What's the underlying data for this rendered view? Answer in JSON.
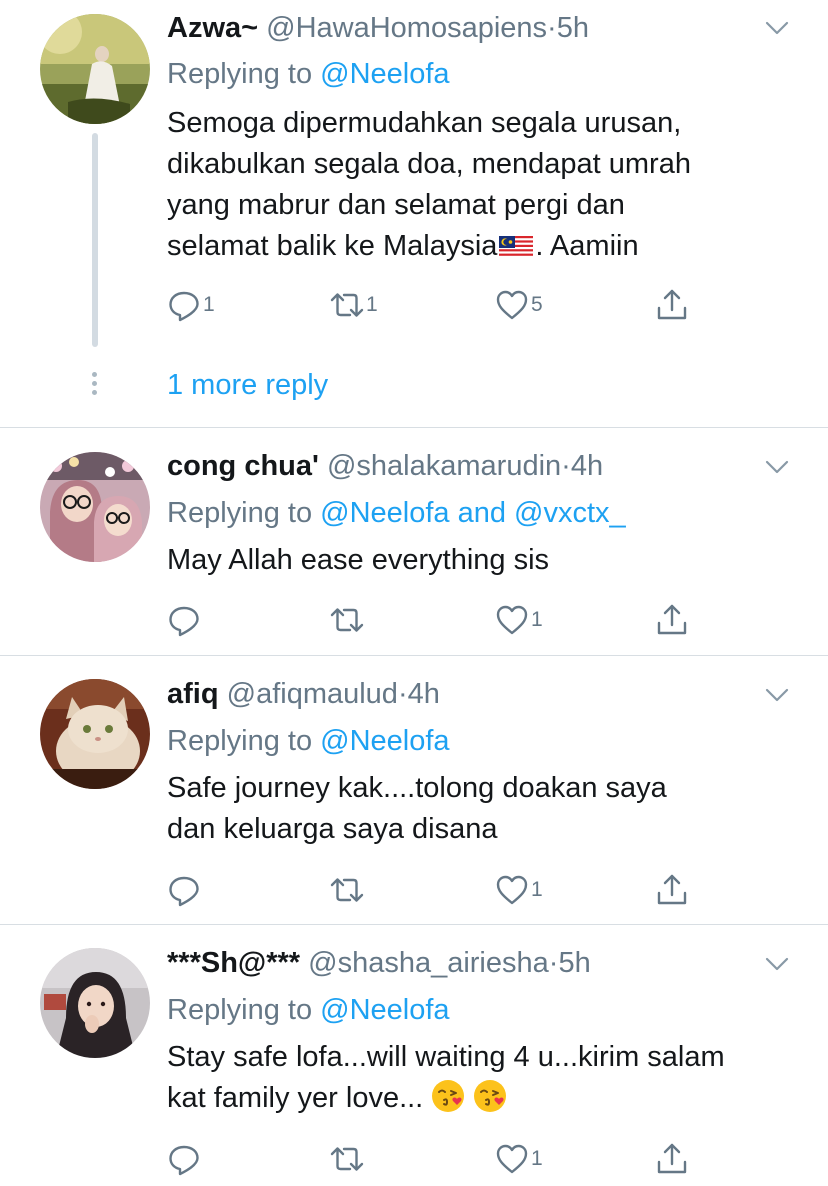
{
  "tweets": [
    {
      "name": "Azwa~",
      "handle": "@HawaHomosapiens",
      "time": "5h",
      "replying_prefix": "Replying to",
      "mentions": "@Neelofa",
      "text_lines": [
        "Semoga dipermudahkan segala urusan,",
        "dikabulkan segala doa, mendapat umrah",
        "yang mabrur dan selamat pergi dan",
        "selamat balik ke Malaysia",
        ". Aamiin"
      ],
      "reply_count": "1",
      "retweet_count": "1",
      "like_count": "5"
    },
    {
      "name": "cong chua'",
      "handle": "@shalakamarudin",
      "time": "4h",
      "replying_prefix": "Replying to",
      "mentions": "@Neelofa and @vxctx_",
      "text_lines": [
        "May Allah ease everything sis"
      ],
      "reply_count": "",
      "retweet_count": "",
      "like_count": "1"
    },
    {
      "name": "afiq",
      "handle": "@afiqmaulud",
      "time": "4h",
      "replying_prefix": "Replying to",
      "mentions": "@Neelofa",
      "text_lines": [
        "Safe journey kak....tolong doakan saya",
        "dan keluarga saya disana"
      ],
      "reply_count": "",
      "retweet_count": "",
      "like_count": "1"
    },
    {
      "name": "***Sh@***",
      "handle": "@shasha_airiesha",
      "time": "5h",
      "replying_prefix": "Replying to",
      "mentions": "@Neelofa",
      "text_lines": [
        "Stay safe lofa...will waiting 4 u...kirim salam",
        "kat family yer love..."
      ],
      "reply_count": "",
      "retweet_count": "",
      "like_count": "1"
    }
  ],
  "thread": {
    "more_reply_label": "1 more reply"
  },
  "icons": {
    "reply": "reply-icon",
    "retweet": "retweet-icon",
    "like": "heart-icon",
    "share": "share-icon",
    "menu": "chevron-down-icon",
    "flag": "malaysia-flag-emoji",
    "emoji": "face-blowing-kiss-emoji"
  },
  "colors": {
    "link": "#1da1f2",
    "secondary": "#657786",
    "text": "#14171a",
    "divider": "#d8dee3"
  }
}
